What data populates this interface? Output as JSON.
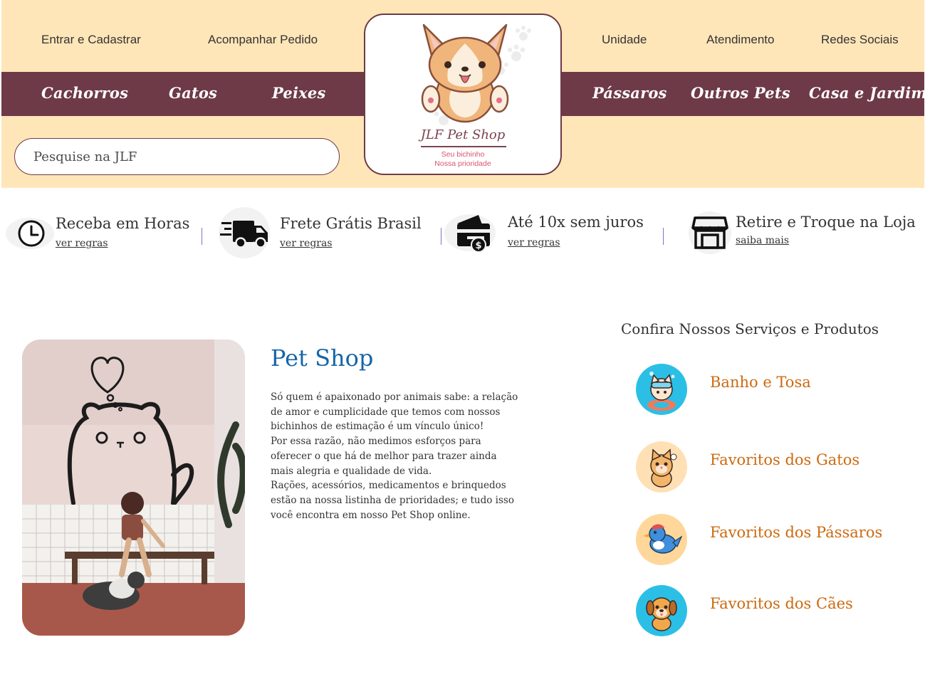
{
  "header": {
    "top_links": [
      "Entrar e Cadastrar",
      "Acompanhar Pedido",
      "Unidade",
      "Atendimento",
      "Redes Sociais"
    ],
    "nav": [
      "Cachorros",
      "Gatos",
      "Peixes",
      "Pássaros",
      "Outros Pets",
      "Casa e Jardim"
    ],
    "search_placeholder": "Pesquise na JLF",
    "logo": {
      "title": "JLF Pet Shop",
      "subtitle_line1": "Seu bichinho",
      "subtitle_line2": "Nossa prioridade"
    }
  },
  "features": [
    {
      "title": "Receba em Horas",
      "link": "ver regras",
      "icon": "clock-icon"
    },
    {
      "title": "Frete Grátis Brasil",
      "link": "ver regras",
      "icon": "delivery-truck-icon"
    },
    {
      "title": "Até 10x sem juros",
      "link": "ver regras",
      "icon": "credit-card-icon"
    },
    {
      "title": "Retire e Troque na Loja",
      "link": "saiba mais",
      "icon": "store-icon"
    }
  ],
  "main": {
    "title": "Pet Shop",
    "paragraphs": [
      "Só quem é apaixonado por animais sabe: a relação\nde amor e cumplicidade que temos com nossos\nbichinhos de estimação é um vínculo único!",
      "Por essa razão, não medimos esforços para\noferecer o que há de melhor para trazer ainda\nmais alegria e qualidade de vida.",
      "Rações, acessórios, medicamentos e brinquedos\nestão na nossa listinha de prioridades; e tudo isso\nvocê encontra em nosso Pet Shop online."
    ],
    "photo": "woman-with-dog-photo"
  },
  "services": {
    "title": "Confira Nossos Serviços e Produtos",
    "items": [
      {
        "label": "Banho e Tosa",
        "icon": "bathing-cat-icon",
        "color": "#2bbfe6"
      },
      {
        "label": "Favoritos dos Gatos",
        "icon": "cat-icon",
        "color": "#ffe0b5"
      },
      {
        "label": "Favoritos dos Pássaros",
        "icon": "bird-icon",
        "color": "#ffd79a"
      },
      {
        "label": "Favoritos dos Cães",
        "icon": "dog-icon",
        "color": "#2bbfe6"
      }
    ]
  },
  "colors": {
    "header_bg": "#ffe6b9",
    "nav_bg": "#6e3a47",
    "title_blue": "#1565a8",
    "service_orange": "#cc6a10"
  }
}
